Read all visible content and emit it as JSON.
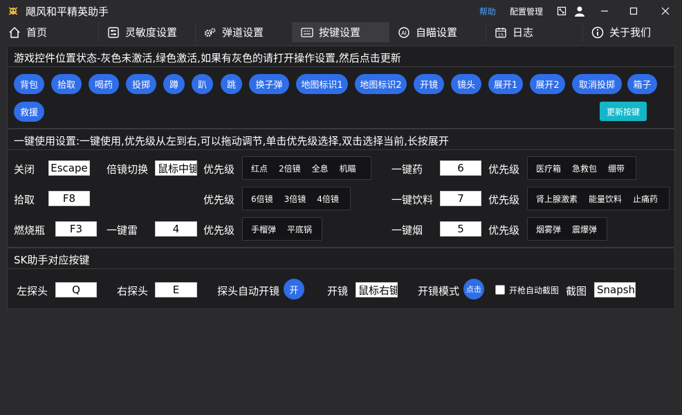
{
  "window": {
    "title": "飓风和平精英助手",
    "help_label": "帮助",
    "config_label": "配置管理"
  },
  "tabs": [
    {
      "label": "首页",
      "icon": "home-icon"
    },
    {
      "label": "灵敏度设置",
      "icon": "sliders-icon"
    },
    {
      "label": "弹道设置",
      "icon": "gears-icon"
    },
    {
      "label": "按键设置",
      "icon": "keyboard-icon"
    },
    {
      "label": "自瞄设置",
      "icon": "ai-icon"
    },
    {
      "label": "日志",
      "icon": "calendar-icon"
    },
    {
      "label": "关于我们",
      "icon": "info-icon"
    }
  ],
  "controls_panel": {
    "title": "游戏控件位置状态-灰色未激活,绿色激活,如果有灰色的请打开操作设置,然后点击更新",
    "buttons": [
      "背包",
      "拾取",
      "喝药",
      "投掷",
      "蹲",
      "趴",
      "跳",
      "换子弹",
      "地图标识1",
      "地图标识2",
      "开镜",
      "镜头",
      "展开1",
      "展开2",
      "取消投掷",
      "箱子",
      "救援"
    ],
    "update_label": "更新按键"
  },
  "onekey_panel": {
    "title": "一键使用设置:一键使用,优先级从左到右,可以拖动调节,单击优先级选择,双击选择当前,长按展开",
    "close_label": "关闭",
    "close_value": "Escape",
    "scope_switch_label": "倍镜切换",
    "scope_switch_value": "鼠标中键",
    "priority_label": "优先级",
    "priority_scope_1": [
      "红点",
      "2倍镜",
      "全息",
      "机瞄"
    ],
    "priority_scope_2": [
      "6倍镜",
      "3倍镜",
      "4倍镜"
    ],
    "pickup_label": "拾取",
    "pickup_value": "F8",
    "molotov_label": "燃烧瓶",
    "molotov_value": "F3",
    "grenade_key_label": "一键雷",
    "grenade_key_value": "4",
    "priority_grenade": [
      "手榴弹",
      "平底锅"
    ],
    "med_label": "一键药",
    "med_value": "6",
    "priority_med": [
      "医疗箱",
      "急救包",
      "绷带"
    ],
    "drink_label": "一键饮料",
    "drink_value": "7",
    "priority_drink": [
      "肾上腺激素",
      "能量饮料",
      "止痛药"
    ],
    "smoke_label": "一键烟",
    "smoke_value": "5",
    "priority_smoke": [
      "烟雾弹",
      "震爆弹"
    ]
  },
  "sk_panel": {
    "title": "SK助手对应按键",
    "lean_left_label": "左探头",
    "lean_left_value": "Q",
    "lean_right_label": "右探头",
    "lean_right_value": "E",
    "auto_scope_label": "探头自动开镜",
    "auto_scope_btn": "开",
    "scope_label": "开镜",
    "scope_value": "鼠标右键",
    "scope_mode_label": "开镜模式",
    "scope_mode_btn": "点击",
    "auto_screenshot_label": "开枪自动截图",
    "screenshot_label": "截图",
    "screenshot_value": "Snapshot"
  }
}
